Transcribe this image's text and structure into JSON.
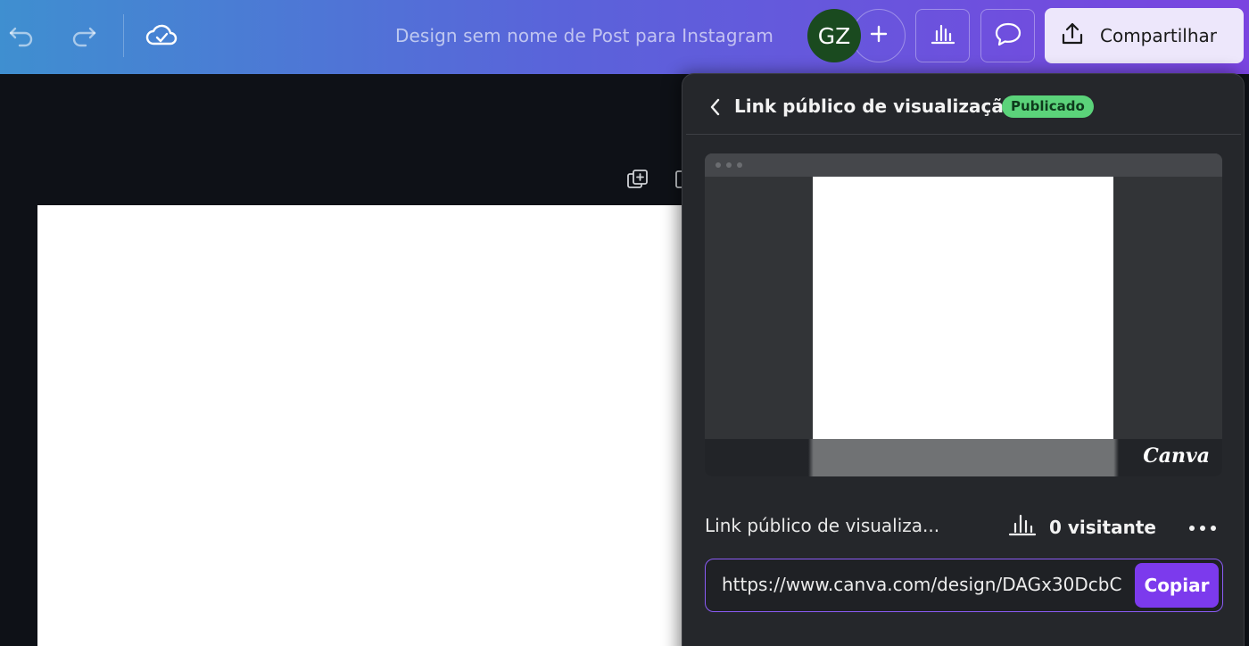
{
  "header": {
    "doc_title": "Design sem nome de Post para Instagram",
    "avatar_initials": "GZ",
    "share_label": "Compartilhar",
    "icons": [
      "undo-icon",
      "redo-icon",
      "cloud-saved-icon",
      "plus-icon",
      "insights-icon",
      "comment-icon",
      "upload-icon"
    ]
  },
  "share_panel": {
    "title": "Link público de visualização",
    "status_badge": "Publicado",
    "preview_brand": "Canva",
    "link_label": "Link público de visualiza...",
    "visitors": "0 visitante",
    "url": "https://www.canva.com/design/DAGx30DcbC",
    "copy_label": "Copiar"
  },
  "colors": {
    "accent": "#7c3aed",
    "badge_green": "#5bd37a",
    "panel_bg": "#25272b",
    "editor_bg": "#0e1117"
  }
}
